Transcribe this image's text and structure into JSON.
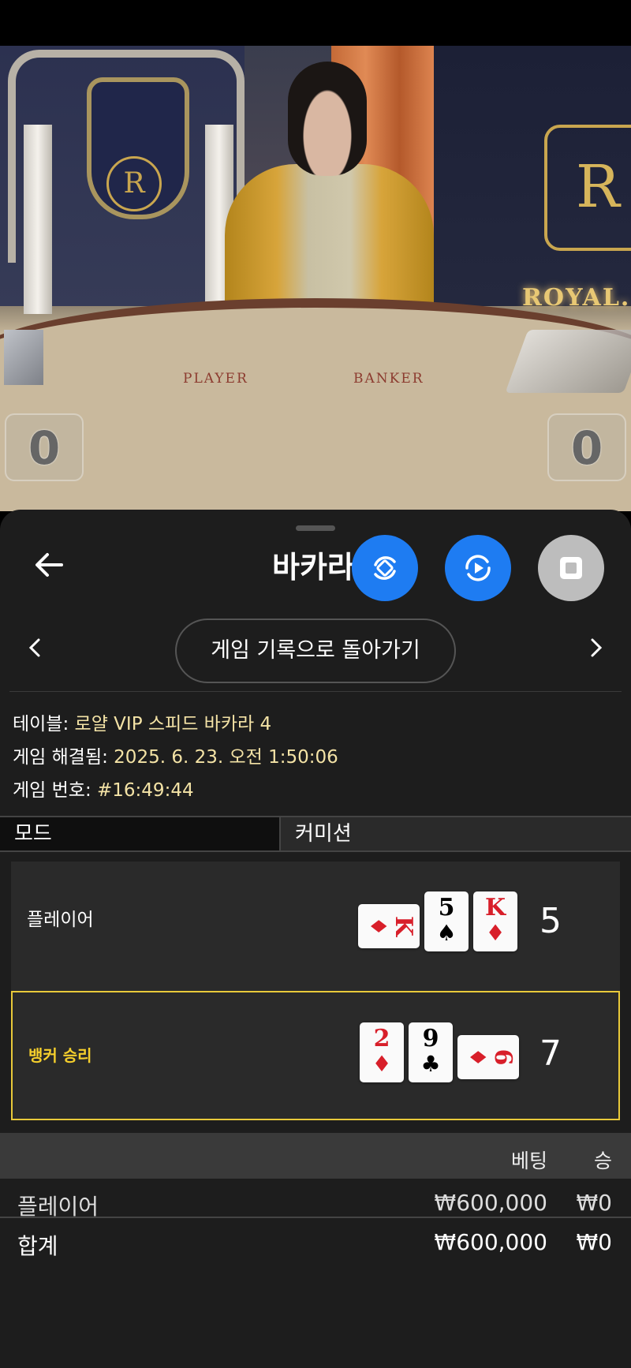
{
  "video": {
    "player_label": "PLAYER",
    "banker_label": "BANKER",
    "crest_letter": "R",
    "brand_text": "ROYAL.",
    "left_score": "0",
    "right_score": "0"
  },
  "header": {
    "title": "바카라",
    "back_icon": "arrow-left-icon",
    "fab_icons": [
      "rotate-sync-icon",
      "replay-icon",
      "stop-icon"
    ]
  },
  "nav": {
    "history_button": "게임 기록으로 돌아가기",
    "prev_icon": "chevron-left-icon",
    "next_icon": "chevron-right-icon"
  },
  "info": {
    "table_label": "테이블: ",
    "table_value": "로얄 VIP 스피드 바카라 4",
    "resolved_label": "게임 해결됨: ",
    "resolved_value": "2025. 6. 23. 오전 1:50:06",
    "game_no_label": "게임 번호: ",
    "game_no_value": "#16:49:44"
  },
  "tabs": {
    "mode": "모드",
    "commission": "커미션"
  },
  "hands": {
    "player": {
      "label": "플레이어",
      "total": "5",
      "cards": [
        {
          "rank": "K",
          "suit": "♦",
          "color": "#d81f2a",
          "sideways": true
        },
        {
          "rank": "5",
          "suit": "♠",
          "color": "#000000",
          "sideways": false
        },
        {
          "rank": "K",
          "suit": "♦",
          "color": "#d81f2a",
          "sideways": false
        }
      ]
    },
    "banker": {
      "label": "뱅커 승리",
      "total": "7",
      "cards": [
        {
          "rank": "2",
          "suit": "♦",
          "color": "#d81f2a",
          "sideways": false
        },
        {
          "rank": "9",
          "suit": "♣",
          "color": "#000000",
          "sideways": false
        },
        {
          "rank": "6",
          "suit": "♦",
          "color": "#d81f2a",
          "sideways": true
        }
      ]
    },
    "win_color": "#e8c93a"
  },
  "bets": {
    "col_bet": "베팅",
    "col_win": "승",
    "rows": [
      {
        "name": "플레이어",
        "bet": "₩600,000",
        "win": "₩0"
      }
    ],
    "total": {
      "name": "합계",
      "bet": "₩600,000",
      "win": "₩0"
    }
  },
  "colors": {
    "accent_blue": "#1e7cf2",
    "value_text": "#f4e3a6",
    "win_label": "#f5cf2c"
  }
}
